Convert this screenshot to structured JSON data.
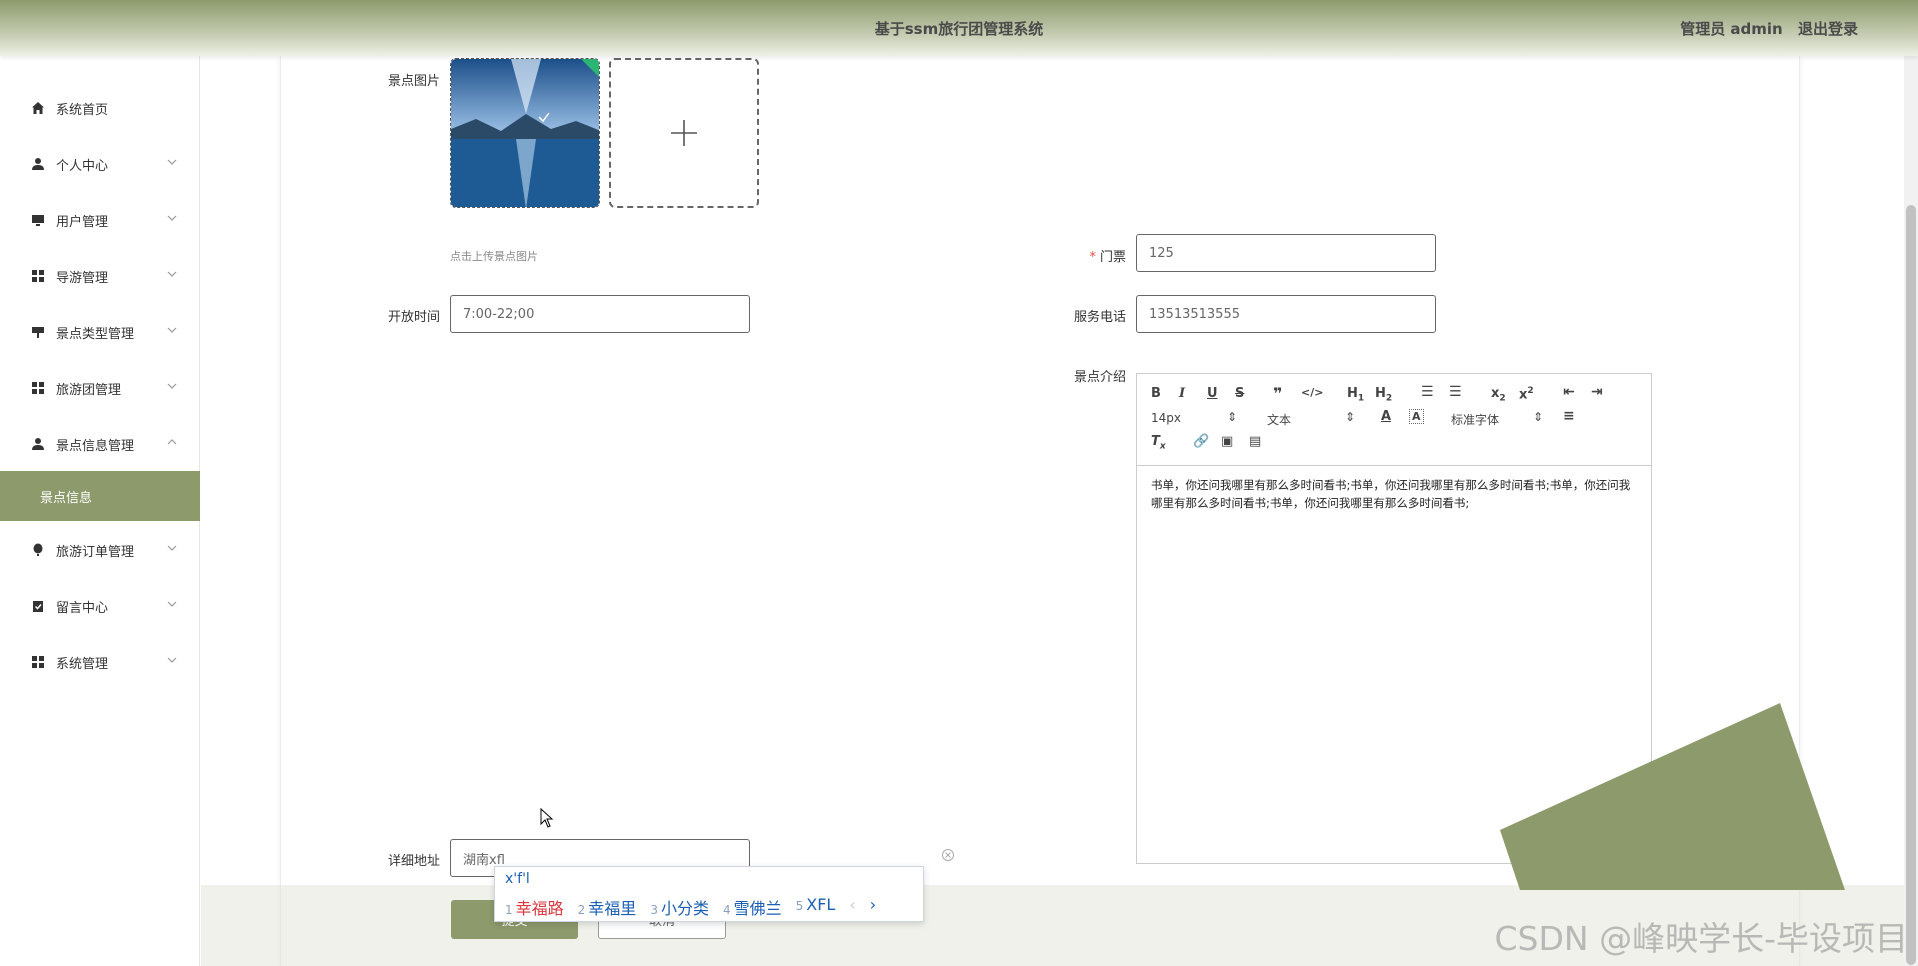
{
  "header": {
    "title": "基于ssm旅行团管理系统",
    "user_label": "管理员 admin",
    "logout_label": "退出登录"
  },
  "sidebar": {
    "items": [
      {
        "label": "系统首页",
        "icon": "home-icon"
      },
      {
        "label": "个人中心",
        "icon": "person-icon"
      },
      {
        "label": "用户管理",
        "icon": "monitor-icon"
      },
      {
        "label": "导游管理",
        "icon": "grid-icon"
      },
      {
        "label": "景点类型管理",
        "icon": "signpost-icon"
      },
      {
        "label": "旅游团管理",
        "icon": "grid-icon"
      },
      {
        "label": "景点信息管理",
        "icon": "person-icon"
      },
      {
        "label": "旅游订单管理",
        "icon": "balloon-icon"
      },
      {
        "label": "留言中心",
        "icon": "clipboard-check-icon"
      },
      {
        "label": "系统管理",
        "icon": "grid-icon"
      }
    ],
    "active_sub": "景点信息"
  },
  "form": {
    "image_label": "景点图片",
    "image_hint": "点击上传景点图片",
    "ticket_label": "门票",
    "ticket_value": "125",
    "open_time_label": "开放时间",
    "open_time_value": "7:00-22;00",
    "phone_label": "服务电话",
    "phone_value": "13513513555",
    "intro_label": "景点介绍",
    "address_label": "详细地址",
    "address_value": "湖南xfl",
    "submit_label": "提交",
    "cancel_label": "取消"
  },
  "editor": {
    "font_size": "14px",
    "block_type": "文本",
    "font_family": "标准字体",
    "content": "书单，你还问我哪里有那么多时间看书;书单，你还问我哪里有那么多时间看书;书单，你还问我哪里有那么多时间看书;书单，你还问我哪里有那么多时间看书;"
  },
  "ime": {
    "composition": "x'f'l",
    "candidates": [
      {
        "n": "1",
        "text": "幸福路"
      },
      {
        "n": "2",
        "text": "幸福里"
      },
      {
        "n": "3",
        "text": "小分类"
      },
      {
        "n": "4",
        "text": "雪佛兰"
      },
      {
        "n": "5",
        "text": "XFL"
      }
    ]
  },
  "watermark": "CSDN @峰映学长-毕设项目",
  "colors": {
    "accent": "#8c9a6c",
    "required": "#e74c3c"
  }
}
